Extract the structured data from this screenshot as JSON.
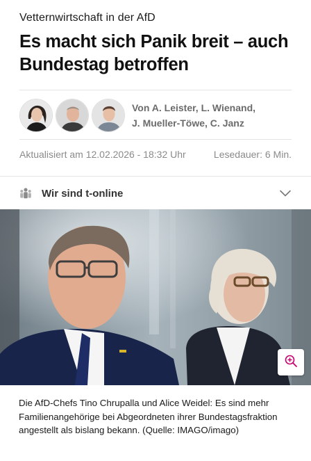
{
  "article": {
    "kicker": "Vetternwirtschaft in der AfD",
    "headline": "Es macht sich Panik breit – auch Bundestag betroffen",
    "authors_line1": "Von A. Leister, L. Wienand,",
    "authors_line2": "J. Mueller-Töwe, C. Janz",
    "updated": "Aktualisiert am 12.02.2026 - 18:32 Uhr",
    "reading_time": "Lesedauer: 6 Min."
  },
  "brand": {
    "label": "Wir sind t-online",
    "icon": "people-icon",
    "chevron": "chevron-down-icon"
  },
  "hero": {
    "caption": "Die AfD-Chefs Tino Chrupalla und Alice Weidel: Es sind mehr Familienangehörige bei Abgeordneten ihrer Bundestagsfraktion angestellt als bislang bekann. (Quelle: IMAGO/imago)",
    "zoom_icon": "zoom-in-icon",
    "accent": "#c8006e"
  }
}
